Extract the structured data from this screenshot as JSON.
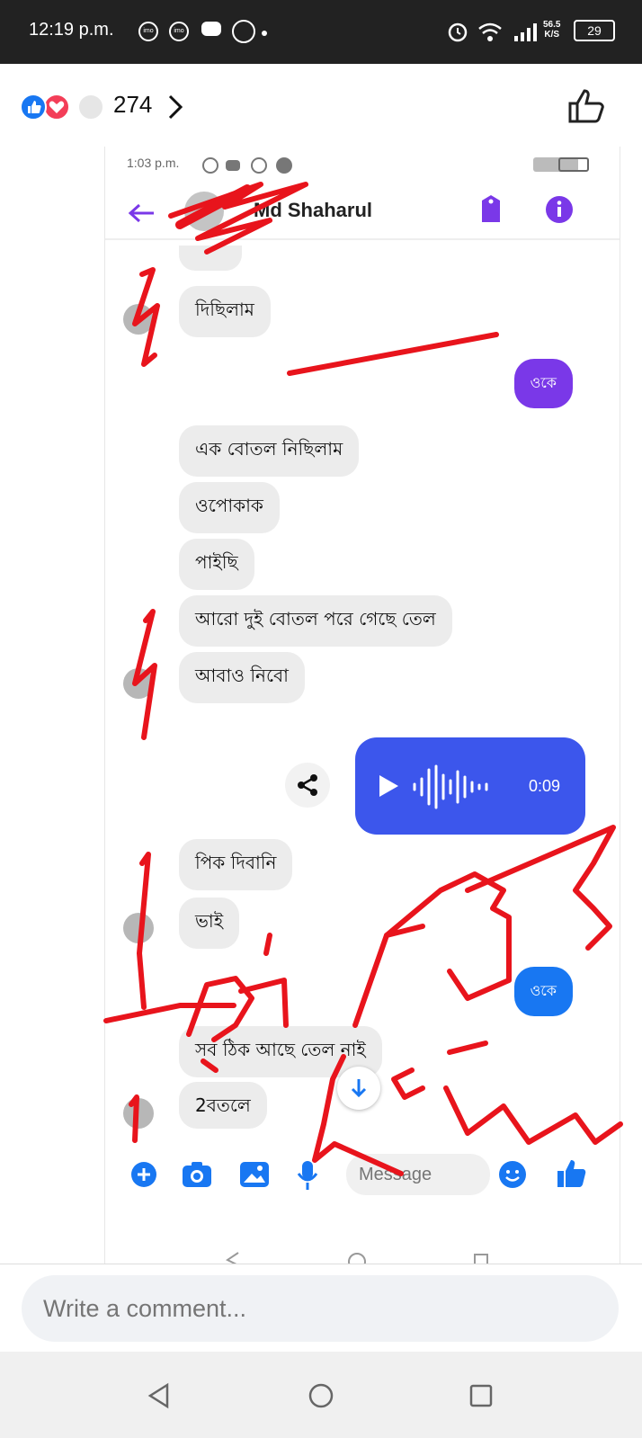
{
  "status_bar": {
    "time": "12:19 p.m.",
    "network_speed_top": "56.5",
    "network_speed_unit": "K/S",
    "battery": "29"
  },
  "post_header": {
    "reaction_count": "274",
    "reaction_colors": {
      "like": "#1877f2",
      "love": "#f33e58"
    }
  },
  "screenshot": {
    "inner_time": "1:03 p.m.",
    "contact_name": "Md Shaharul",
    "accent_color": "#7a38e8",
    "messages": [
      {
        "side": "left",
        "text": "দিছিলাম"
      },
      {
        "side": "right",
        "text": "ওকে"
      },
      {
        "side": "left",
        "text": "এক বোতল নিছিলাম"
      },
      {
        "side": "left",
        "text": "ওপোকাক"
      },
      {
        "side": "left",
        "text": "পাইছি"
      },
      {
        "side": "left",
        "text": "আরো দুই বোতল পরে গেছে তেল"
      },
      {
        "side": "left",
        "text": "আবাও নিবো"
      },
      {
        "side": "left",
        "text": "পিক দিবানি"
      },
      {
        "side": "left",
        "text": "ভাই"
      },
      {
        "side": "right",
        "text": "ওকে"
      },
      {
        "side": "left",
        "text": "সব ঠিক আছে তেল নাই"
      },
      {
        "side": "left",
        "text": "2বতলে"
      }
    ],
    "voice_message": {
      "duration": "0:09"
    },
    "message_placeholder": "Message"
  },
  "comment_bar": {
    "placeholder": "Write a comment..."
  }
}
